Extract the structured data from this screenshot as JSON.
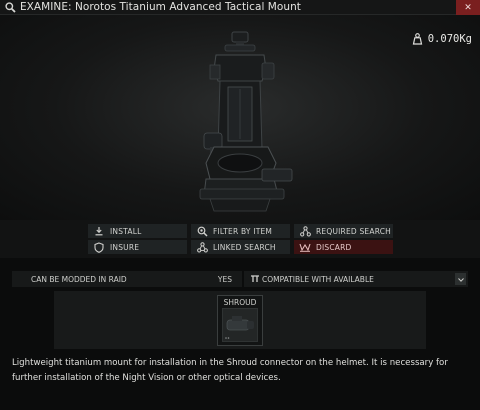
{
  "window": {
    "title": "EXAMINE: Norotos Titanium Advanced Tactical Mount",
    "close_label": "✕",
    "weight": "0.070Kg"
  },
  "icons": {
    "title": "magnifier-icon",
    "weight": "weight-icon",
    "install": "install-icon",
    "filter": "filter-icon",
    "required": "required-search-icon",
    "insure": "shield-icon",
    "linked": "linked-search-icon",
    "discard": "discard-icon",
    "compatible": "compatible-icon"
  },
  "actions": {
    "install": "INSTALL",
    "filter_by_item": "FILTER BY ITEM",
    "required_search": "REQUIRED SEARCH",
    "insure": "INSURE",
    "linked_search": "LINKED SEARCH",
    "discard": "DISCARD"
  },
  "properties": {
    "moddable_label": "CAN BE MODDED IN RAID",
    "moddable_value": "YES",
    "compatibility": "COMPATIBLE WITH AVAILABLE"
  },
  "slots": [
    {
      "label": "SHROUD"
    }
  ],
  "description": "Lightweight titanium mount for installation in the Shroud connector on the helmet. It is necessary for further installation of the Night Vision or other optical devices.",
  "colors": {
    "discard_bg": "#3b1212",
    "close_bg": "#7a1f1f"
  }
}
